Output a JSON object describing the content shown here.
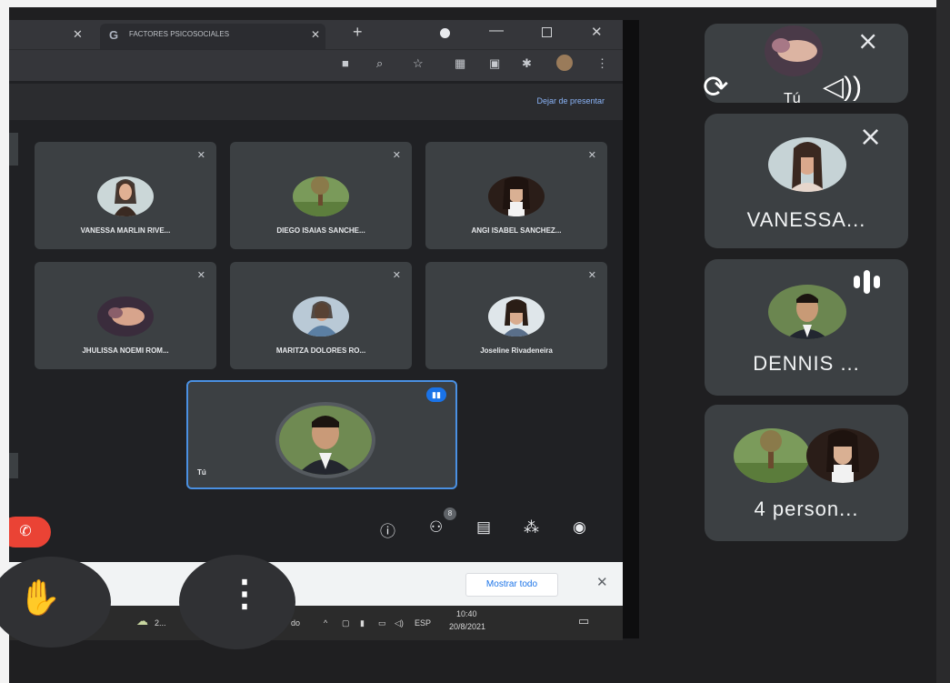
{
  "browser": {
    "tab_title": "FACTORES PSICOSOCIALES",
    "tab_favicon": "G",
    "stop_presenting": "Dejar de presentar",
    "participants": [
      {
        "name": "VANESSA MARLIN RIVE...",
        "photo": "woman-photo"
      },
      {
        "name": "DIEGO ISAIAS SANCHE...",
        "photo": "tree-photo"
      },
      {
        "name": "ANGI ISABEL SANCHEZ...",
        "photo": "woman-photo"
      },
      {
        "name": "JHULISSA NOEMI ROM...",
        "photo": "hand-photo"
      },
      {
        "name": "MARITZA DOLORES RO...",
        "photo": "woman-photo"
      },
      {
        "name": "Joseline Rivadeneira",
        "photo": "woman-photo"
      }
    ],
    "self_label": "Tú",
    "participants_badge": "8",
    "download_bar": {
      "show_all": "Mostrar todo"
    },
    "taskbar": {
      "weather": "2...",
      "partial_text": "do",
      "lang": "ESP",
      "time": "10:40",
      "date": "20/8/2021"
    }
  },
  "phone_panel": {
    "self_label": "Tú",
    "cards": [
      {
        "label": "VANESSA..."
      },
      {
        "label": "DENNIS ..."
      },
      {
        "label": "4 person..."
      }
    ]
  },
  "colors": {
    "accent": "#1a73e8",
    "end_call": "#ea4335",
    "tile_bg": "#3c4043"
  }
}
